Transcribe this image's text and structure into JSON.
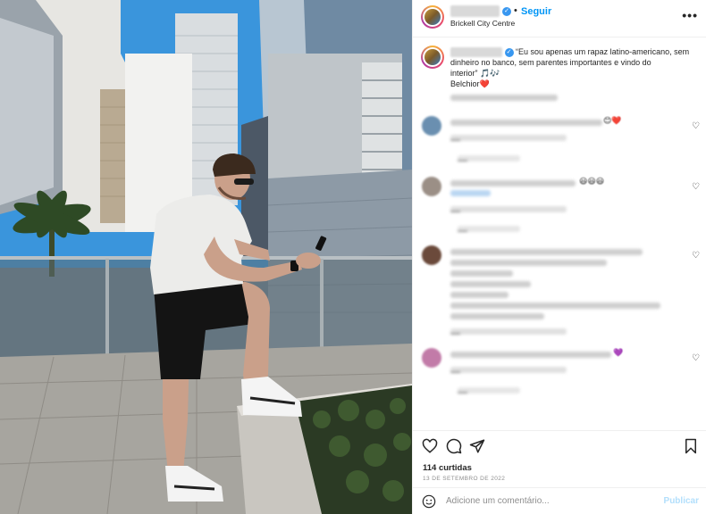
{
  "header": {
    "username": "",
    "follow_label": "Seguir",
    "location": "Brickell City Centre",
    "more_label": "•••"
  },
  "caption": {
    "text_line1": "“Eu sou apenas um rapaz latino-americano, sem",
    "text_line2": "dinheiro no banco, sem parentes importantes e vindo do",
    "text_line3": "interior” 🎵🎶",
    "text_line4": "Belchior",
    "heart": "❤️"
  },
  "comments": [
    {
      "time_row": "—",
      "replies": "—"
    },
    {
      "time_row": "—",
      "replies": "—"
    },
    {
      "time_row": "—",
      "replies": "—"
    },
    {
      "time_row": "—",
      "replies": "—"
    }
  ],
  "actions": {
    "likes": "114 curtidas",
    "date": "13 DE SETEMBRO DE 2022"
  },
  "add_comment": {
    "placeholder": "Adicione um comentário...",
    "publish_label": "Publicar"
  },
  "colors": {
    "accent": "#0095f6",
    "verified": "#3897f0",
    "publish_disabled": "#b2dffc",
    "sky": "#2f8fd8"
  },
  "icons": [
    "more-icon",
    "verified-icon",
    "heart-icon",
    "comment-icon",
    "share-icon",
    "bookmark-icon",
    "emoji-icon"
  ]
}
